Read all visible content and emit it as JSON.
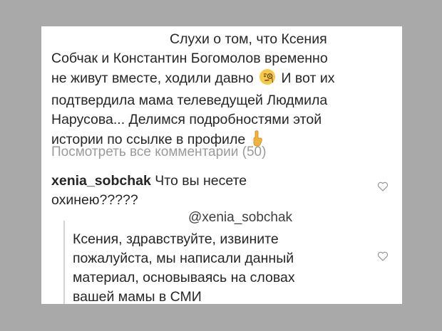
{
  "post": {
    "caption_lines": [
      "Слухи о том, что Ксения",
      "Собчак и Константин Богомолов временно",
      "не живут вместе, ходили давно",
      "И вот их",
      "подтвердила мама телеведущей Людмила",
      "Нарусова... Делимся подробностями этой",
      "истории по ссылке в профиле"
    ],
    "emoji_1": "monocle-face",
    "emoji_2": "pointing-down-finger"
  },
  "comments": {
    "view_all_label": "Посмотреть все комментарии (50)",
    "first": {
      "username": "xenia_sobchak",
      "text_line1": "Что вы несете",
      "text_line2": "охинею?????"
    },
    "reply": {
      "mention": "@xenia_sobchak",
      "lines": [
        "Ксения, здравствуйте, извините",
        "пожалуйста, мы написали данный",
        "материал, основываясь на словах",
        "вашей мамы в СМИ"
      ]
    }
  },
  "colors": {
    "background": "#a9a9a9",
    "card": "#ffffff",
    "text": "#262626",
    "muted": "#9a9a9a"
  }
}
